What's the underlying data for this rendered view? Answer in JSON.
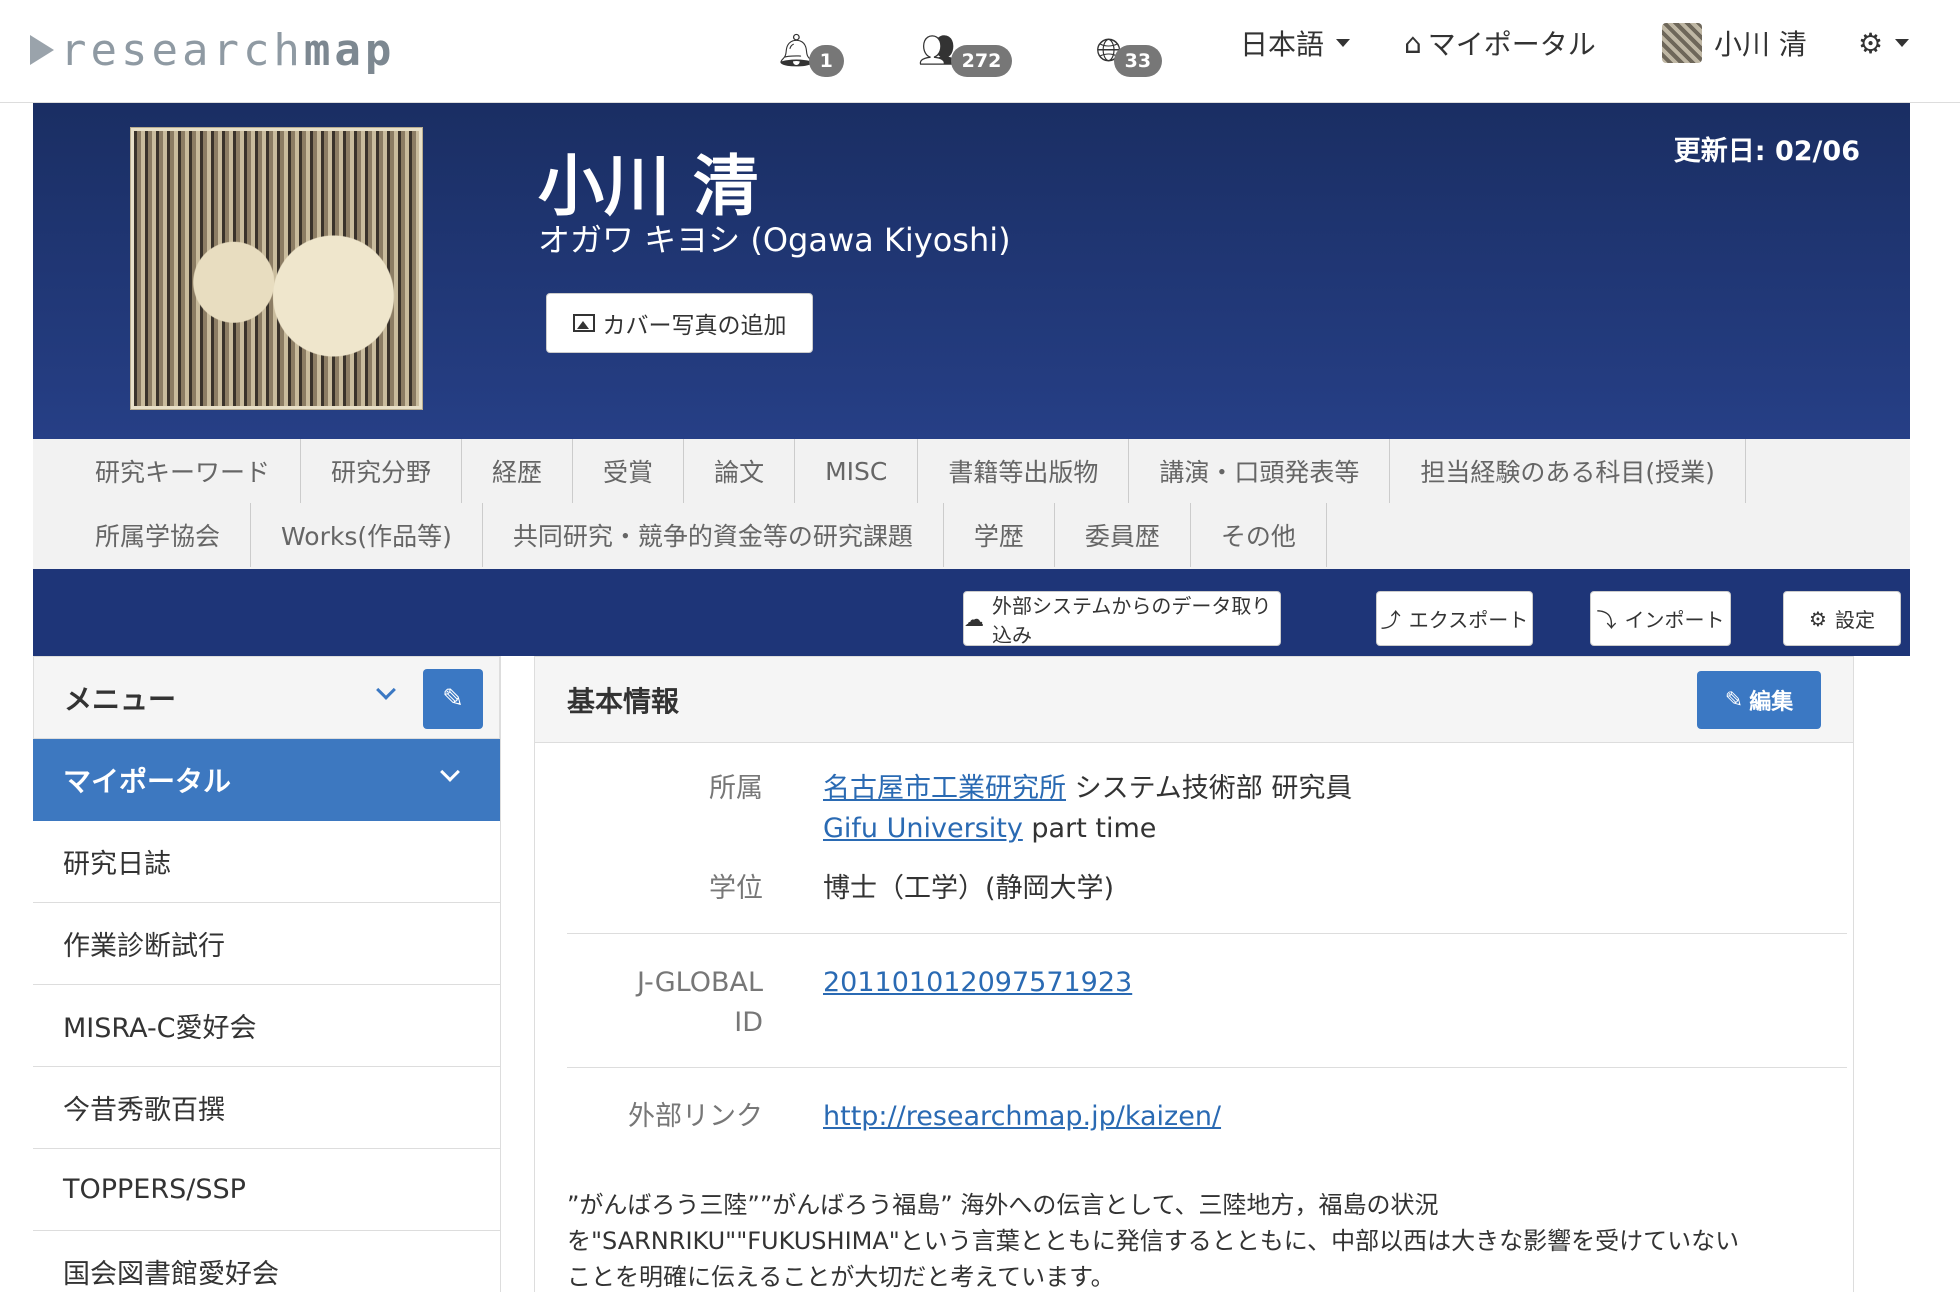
{
  "logo": {
    "text_a": "research",
    "text_b": "map"
  },
  "nav": {
    "notifications_count": "1",
    "connections_count": "272",
    "globe_count": "33",
    "language": "日本語",
    "my_portal": "マイポータル",
    "user_name": "小川 清"
  },
  "header": {
    "name": "小川 清",
    "kana": "オガワ キヨシ (Ogawa Kiyoshi)",
    "cover_button": "カバー写真の追加",
    "updated": "更新日: 02/06"
  },
  "tabs": {
    "row1": [
      "研究キーワード",
      "研究分野",
      "経歴",
      "受賞",
      "論文",
      "MISC",
      "書籍等出版物",
      "講演・口頭発表等",
      "担当経験のある科目(授業)"
    ],
    "row2": [
      "所属学協会",
      "Works(作品等)",
      "共同研究・競争的資金等の研究課題",
      "学歴",
      "委員歴",
      "その他"
    ]
  },
  "toolbar": {
    "import_external": "外部システムからのデータ取り込み",
    "export": "エクスポート",
    "import": "インポート",
    "settings": "設定"
  },
  "sidebar": {
    "menu_title": "メニュー",
    "active": "マイポータル",
    "items": [
      "研究日誌",
      "作業診断試行",
      "MISRA-C愛好会",
      "今昔秀歌百撰",
      "TOPPERS/SSP",
      "国会図書館愛好会"
    ]
  },
  "panel": {
    "title": "基本情報",
    "edit": "編集",
    "affiliation_label": "所属",
    "affiliation_1_link": "名古屋市工業研究所",
    "affiliation_1_rest": " システム技術部 研究員",
    "affiliation_2_link": "Gifu University",
    "affiliation_2_rest": " part time",
    "degree_label": "学位",
    "degree": "博士（工学）(静岡大学)",
    "jglobal_label_1": "J-GLOBAL",
    "jglobal_label_2": "ID",
    "jglobal_id": "201101012097571923",
    "external_label": "外部リンク",
    "external_url": "http://researchmap.jp/kaizen/",
    "description_1": "”がんばろう三陸””がんばろう福島” 海外への伝言として、三陸地方，福島の状況",
    "description_2": "を\"SARNRIKU\"\"FUKUSHIMA\"という言葉とともに発信するとともに、中部以西は大きな影響を受けていない",
    "description_3": "ことを明確に伝えることが大切だと考えています。"
  },
  "colors": {
    "header_bg": "#22397a",
    "accent": "#3b78c3",
    "link": "#2a6ab3"
  }
}
